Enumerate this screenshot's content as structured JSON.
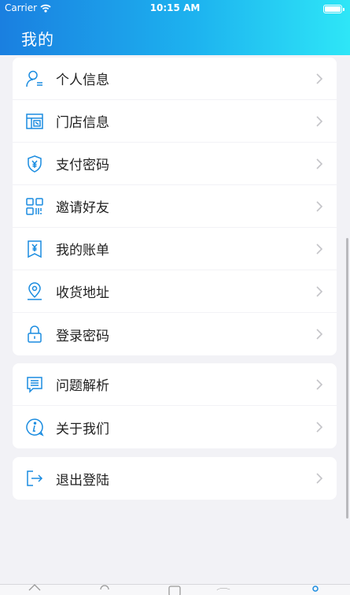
{
  "status_bar": {
    "carrier": "Carrier",
    "time": "10:15 AM"
  },
  "header": {
    "title": "我的"
  },
  "menu_groups": [
    {
      "items": [
        {
          "label": "个人信息",
          "icon": "user-profile-icon"
        },
        {
          "label": "门店信息",
          "icon": "store-icon"
        },
        {
          "label": "支付密码",
          "icon": "shield-yuan-icon"
        },
        {
          "label": "邀请好友",
          "icon": "qr-code-icon"
        },
        {
          "label": "我的账单",
          "icon": "bill-icon"
        },
        {
          "label": "收货地址",
          "icon": "location-pin-icon"
        },
        {
          "label": "登录密码",
          "icon": "lock-icon"
        }
      ]
    },
    {
      "items": [
        {
          "label": "问题解析",
          "icon": "message-list-icon"
        },
        {
          "label": "关于我们",
          "icon": "info-icon"
        }
      ]
    },
    {
      "items": [
        {
          "label": "退出登陆",
          "icon": "logout-icon"
        }
      ]
    }
  ],
  "colors": {
    "accent": "#1a8ce0",
    "header_start": "#1a7fe0",
    "header_end": "#2ee6f7",
    "background": "#f2f2f6"
  }
}
